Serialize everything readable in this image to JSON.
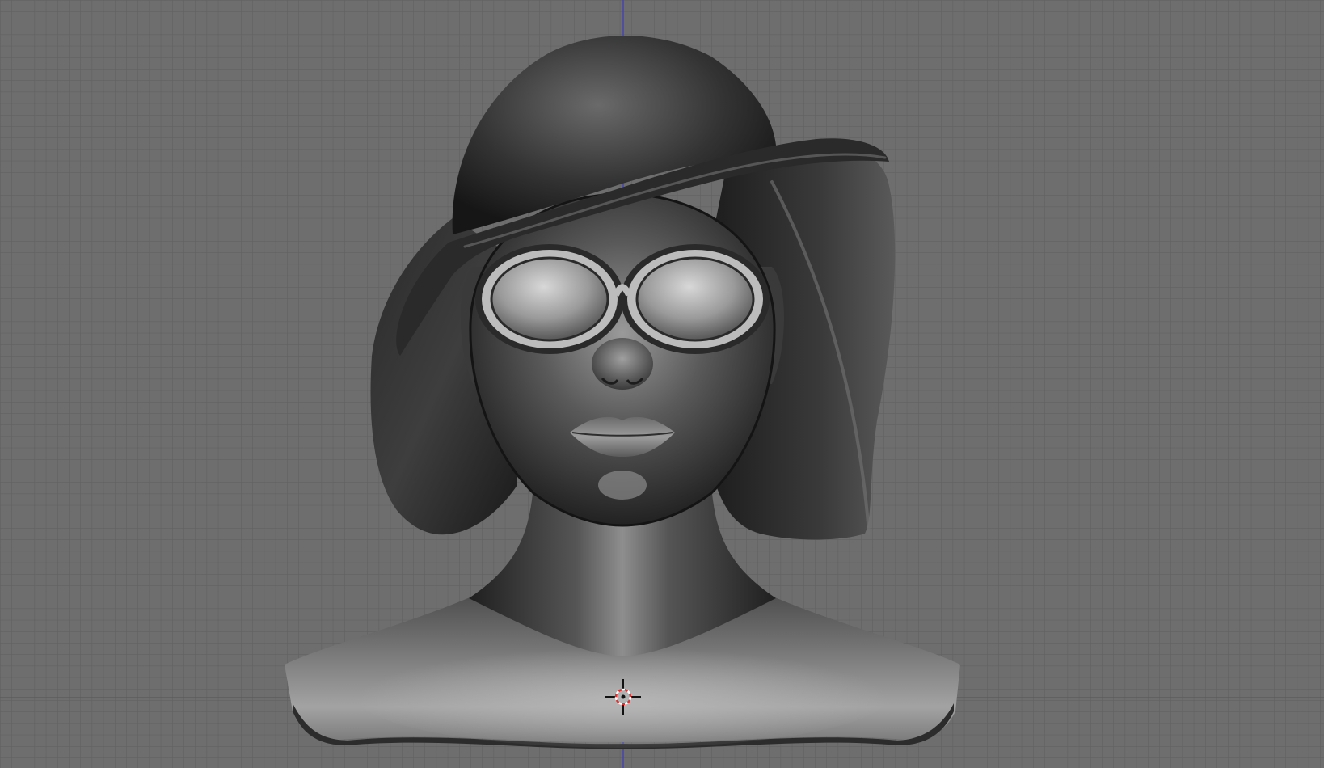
{
  "viewport": {
    "name": "3d-viewport",
    "background_color": "#6e6e6e",
    "grid_minor_color": "#5e5e5e",
    "grid_major_color": "#575757",
    "axis_x_color": "#a33a3a",
    "axis_y_color": "#3b3bbb"
  },
  "scene": {
    "object": "sculpted-bust-with-hat-and-sunglasses",
    "cursor_icon": "3d-cursor-icon"
  }
}
